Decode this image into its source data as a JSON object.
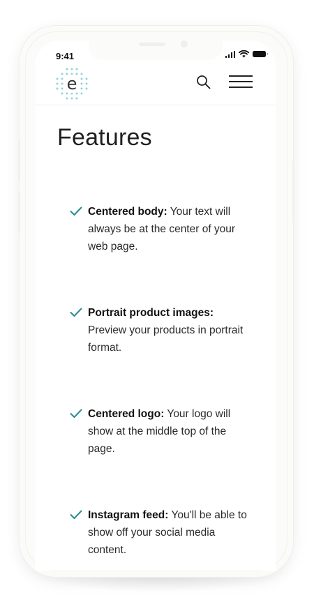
{
  "status_bar": {
    "time": "9:41",
    "signal_icon": "cellular-signal-icon",
    "wifi_icon": "wifi-icon",
    "battery_icon": "battery-icon"
  },
  "header": {
    "logo_letter": "e",
    "logo_icon": "dotted-e-logo",
    "search_icon": "search-icon",
    "menu_icon": "hamburger-menu-icon"
  },
  "page": {
    "title": "Features"
  },
  "features": [
    {
      "title": "Centered body:",
      "description": " Your text will always be at the center of your web page."
    },
    {
      "title": "Portrait product images:",
      "description": " Preview your products in portrait format."
    },
    {
      "title": "Centered logo:",
      "description": " Your logo will show at the middle top of the page."
    },
    {
      "title": "Instagram feed:",
      "description": " You'll be able to show off your social media content."
    }
  ],
  "colors": {
    "accent": "#2a8a94",
    "logo_teal": "#6fc6c7",
    "text": "#2a2a2a",
    "frame": "#fbfbf9"
  }
}
